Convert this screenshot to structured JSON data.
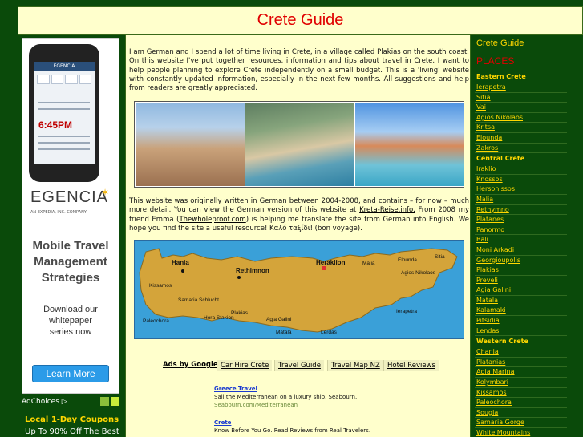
{
  "header": {
    "title": "Crete Guide"
  },
  "left_ad": {
    "phone_screen_title": "EGENCIA",
    "phone_time": "6:45PM",
    "brand": "EGENCIA",
    "brand_tagline": "AN EXPEDIA, INC. COMPANY",
    "headline_lines": [
      "Mobile Travel",
      "Management",
      "Strategies"
    ],
    "sub_lines": [
      "Download our",
      "whitepaper",
      "series now"
    ],
    "button_label": "Learn More",
    "adchoices_label": "AdChoices ▷",
    "coupon_title": "Local 1-Day Coupons",
    "coupon_text": "Up To 90% Off The Best"
  },
  "intro": {
    "text": "I am German and I spend a lot of time living in Crete, in a village called Plakias on the south coast. On this website I've put together resources, information and tips about travel in Crete.  I want to help people planning to explore Crete independently on a small budget. This is a 'living' website with constantly updated information, especially in the next few months. All suggestions and help from readers are greatly appreciated."
  },
  "history": {
    "part1": "This website was originally written in German between 2004-2008, and contains – for now – much more detail. You can view the German version of this website at ",
    "link1": "Kreta-Reise.info.",
    "part2": " From 2008 my friend Emma (",
    "link2": "Thewholeproof.com",
    "part3": ") is helping me translate the site from German into English. We hope you find the site a useful resource! Καλό ταξίδι! (bon voyage)."
  },
  "map": {
    "cities": [
      "Hania",
      "Rethimnon",
      "Heraklion",
      "Malia",
      "Elounda",
      "Sitia",
      "Agios Nikolaos",
      "Kissamos",
      "Samaria Schlucht",
      "Plakias",
      "Paleochora",
      "Hora Sfakion",
      "Agia Galini",
      "Matala",
      "Ierapetra",
      "Lerdas"
    ]
  },
  "ads_bar": {
    "label": "Ads by Google",
    "links": [
      "Car Hire Crete",
      "Travel Guide",
      "Travel Map NZ",
      "Hotel Reviews"
    ]
  },
  "ad_entries": [
    {
      "title": "Greece Travel",
      "desc": "Sail the Mediterranean on a luxury ship. Seabourn.",
      "url": "Seabourn.com/Mediterranean"
    },
    {
      "title": "Crete",
      "desc": "Know Before You Go. Read Reviews from Real Travelers.",
      "url": ""
    }
  ],
  "sidebar": {
    "guide_link": "Crete Guide",
    "places_heading": "PLACES",
    "sections": [
      {
        "heading": "Eastern Crete",
        "items": [
          "Ierapetra",
          "Sitia",
          "Vai",
          "Agios Nikolaos",
          "Kritsa",
          "Elounda",
          "Zakros"
        ]
      },
      {
        "heading": "Central Crete",
        "items": [
          "Iraklio",
          "Knossos",
          "Hersonissos",
          "Malia",
          "Rethymno",
          "Platanes",
          "Panormo",
          "Bali",
          "Moni Arkadi",
          "Georgioupolis",
          "Plakias",
          "Preveli",
          "Agia Galini",
          "Matala",
          "Kalamaki",
          "Pitsidia",
          "Lendas"
        ]
      },
      {
        "heading": "Western Crete",
        "items": [
          "Chania",
          "Platanias",
          "Agia Marina",
          "Kolymbari",
          "Kissamos",
          "Paleochora",
          "Sougia",
          "Samaria Gorge",
          "White Mountains"
        ]
      }
    ]
  },
  "colors": {
    "page_bg": "#0a4a0a",
    "content_bg": "#ffffcc",
    "title_red": "#e00000",
    "link_gold": "#ffd700"
  }
}
